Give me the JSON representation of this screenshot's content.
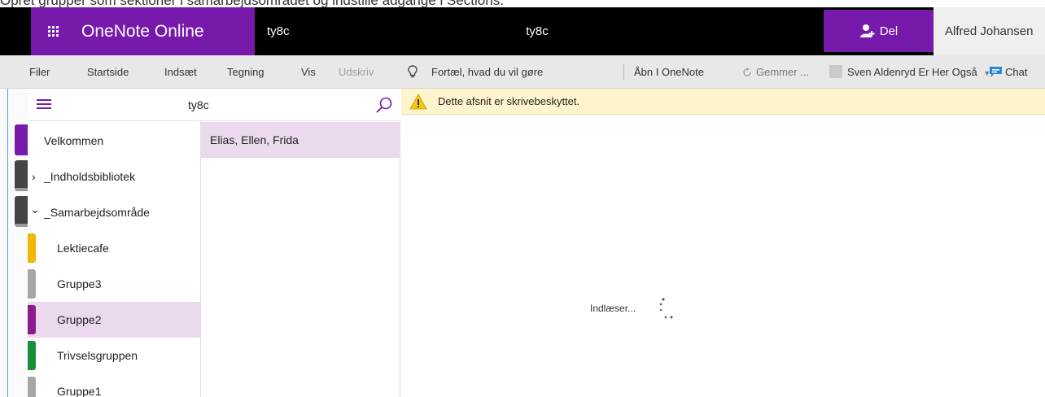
{
  "caption": "Opret grupper som sektioner i samarbejdsområdet og indstille adgange i Sections.",
  "header": {
    "app_name": "OneNote Online",
    "notebook_name": "ty8c",
    "center_title": "ty8c",
    "share_label": "Del",
    "user_name": "Alfred Johansen",
    "accent_color": "#7719aa"
  },
  "ribbon": {
    "file": "Filer",
    "home": "Startside",
    "insert": "Indsæt",
    "draw": "Tegning",
    "view": "Vis",
    "print": "Udskriv",
    "tell_me": "Fortæl, hvad du vil gøre",
    "open_in_onenote": "Åbn I OneNote",
    "saving": "Gemmer ...",
    "coauthor": "Sven Aldenryd Er Her Også",
    "chat": "Chat"
  },
  "navigation": {
    "notebook_title": "ty8c",
    "sections": [
      {
        "label": "Velkommen",
        "color": "#7719aa"
      },
      {
        "label": "_Indholdsbibliotek",
        "chevron": "›"
      },
      {
        "label": "_Samarbejdsområde",
        "chevron": "⌄"
      },
      {
        "label": "Lektiecafe",
        "color": "#f0b800"
      },
      {
        "label": "Gruppe3",
        "color": "#a6a6a6"
      },
      {
        "label": "Gruppe2",
        "color": "#8c1c8c",
        "selected": true
      },
      {
        "label": "Trivselsgruppen",
        "color": "#1a8f3a"
      },
      {
        "label": "Gruppe1",
        "color": "#a6a6a6"
      }
    ]
  },
  "pages": [
    {
      "label": "Elias, Ellen, Frida",
      "selected": true
    }
  ],
  "notice": {
    "text": "Dette afsnit er skrivebeskyttet.",
    "icon": "warning-icon"
  },
  "content": {
    "loading_text": "Indlæser..."
  }
}
